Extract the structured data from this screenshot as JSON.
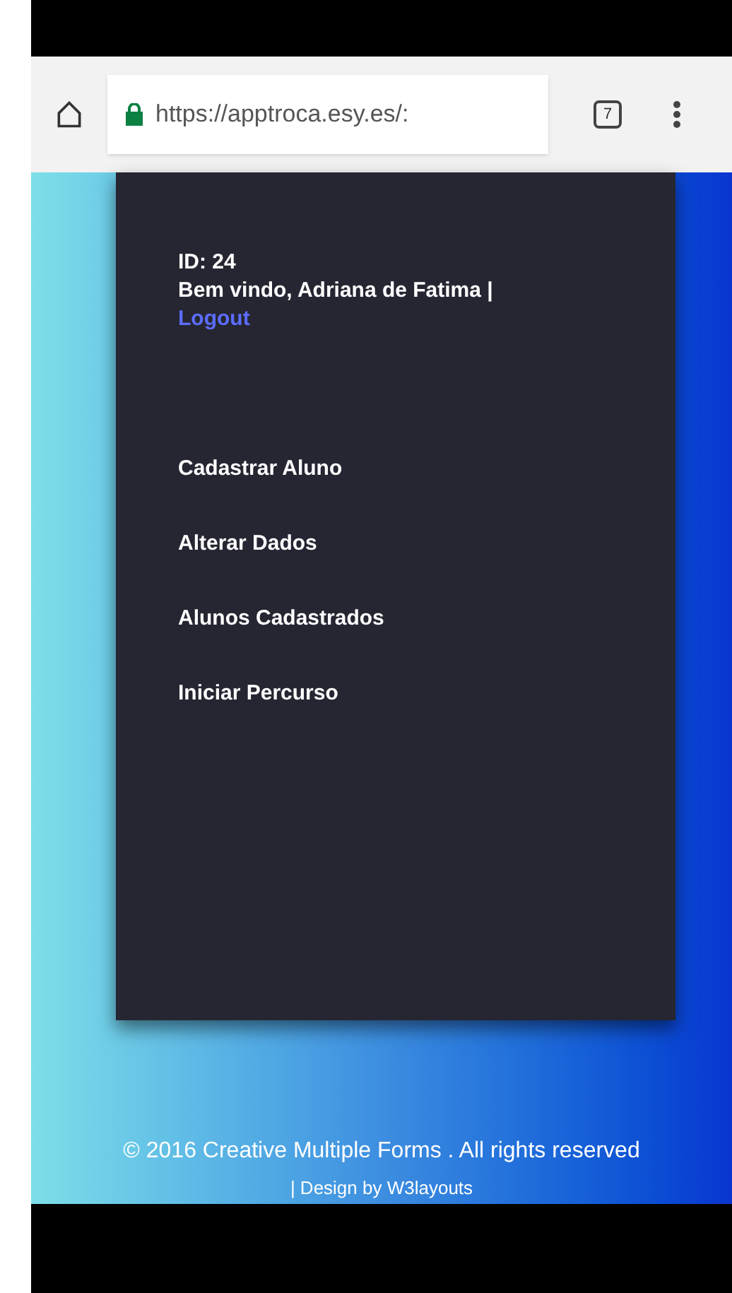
{
  "browser": {
    "url": "https://apptroca.esy.es/:",
    "tab_count": "7"
  },
  "user": {
    "id": "ID: 24",
    "welcome": "Bem vindo, Adriana de Fatima |",
    "logout": "Logout"
  },
  "menu": [
    {
      "label": "Cadastrar Aluno"
    },
    {
      "label": "Alterar Dados"
    },
    {
      "label": "Alunos Cadastrados"
    },
    {
      "label": "Iniciar Percurso"
    }
  ],
  "footer": {
    "copyright": "© 2016 Creative Multiple Forms . All rights reserved",
    "credit": "| Design by W3layouts"
  }
}
